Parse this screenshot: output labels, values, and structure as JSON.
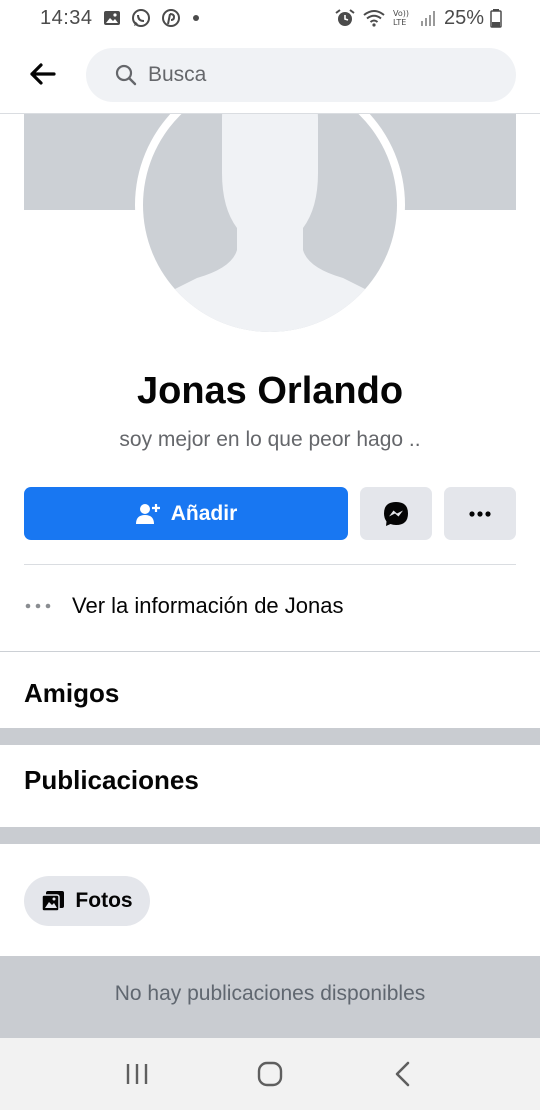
{
  "status_bar": {
    "time": "14:34",
    "battery_text": "25%",
    "icons_left": [
      "gallery-icon",
      "whatsapp-icon",
      "pinterest-icon",
      "dot-icon"
    ],
    "icons_right": [
      "alarm-icon",
      "wifi-icon",
      "volte-icon",
      "signal-icon",
      "battery-icon"
    ]
  },
  "search": {
    "placeholder": "Busca"
  },
  "profile": {
    "name": "Jonas Orlando",
    "bio": "soy mejor en lo que peor hago .."
  },
  "actions": {
    "add_label": "Añadir"
  },
  "info": {
    "label": "Ver la información de Jonas"
  },
  "sections": {
    "friends": "Amigos",
    "posts": "Publicaciones"
  },
  "photos_chip": {
    "label": "Fotos"
  },
  "feed": {
    "empty_text": "No hay publicaciones disponibles"
  },
  "colors": {
    "primary": "#1877f2",
    "secondary_button": "#e4e6eb",
    "band": "#c9ccd1"
  }
}
